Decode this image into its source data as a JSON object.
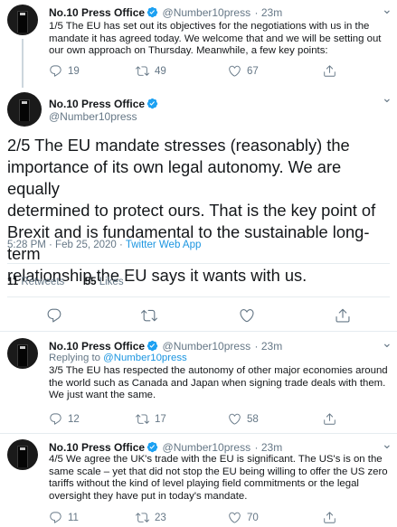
{
  "author": {
    "name": "No.10 Press Office",
    "handle": "@Number10press"
  },
  "tweets": [
    {
      "time": "· 23m",
      "text_lines": [
        "1/5 The EU has set out its objectives for the negotiations with us in the",
        "mandate it has agreed today.  We welcome that and we will be setting out",
        "our own approach on Thursday.  Meanwhile, a few key points:"
      ],
      "replies": "19",
      "retweets": "49",
      "likes": "67"
    },
    {
      "text_lines": [
        "2/5 The EU mandate stresses (reasonably) the",
        "importance of its own legal autonomy. We are equally",
        "determined to protect ours.  That is the key point of",
        "Brexit and is fundamental to the sustainable long-term",
        "relationship the EU says it wants with us."
      ],
      "timestamp": "5:28 PM · Feb 25, 2020 · ",
      "app": "Twitter Web App",
      "retweets_count": "11",
      "retweets_label": "Retweets",
      "likes_count": "55",
      "likes_label": "Likes"
    },
    {
      "time": "· 23m",
      "reply_prefix": "Replying to ",
      "reply_to": "@Number10press",
      "text_lines": [
        "3/5 The EU has respected the autonomy of other major economies around",
        "the world such as Canada and Japan when signing trade deals with them.",
        "We just want the same."
      ],
      "replies": "12",
      "retweets": "17",
      "likes": "58"
    },
    {
      "time": "· 23m",
      "text_lines": [
        "4/5 We agree the UK's trade with the EU is significant.  The US's is on the",
        "same scale – yet that did not stop the EU being willing to offer the US zero",
        "tariffs without the kind of level playing field commitments or the legal",
        "oversight they have put in today's mandate."
      ],
      "replies": "11",
      "retweets": "23",
      "likes": "70"
    }
  ],
  "colors": {
    "text": "#14171a",
    "muted": "#657786",
    "link": "#1b95e0",
    "verified": "#1da1f2",
    "divider": "#e6ecf0"
  },
  "icons": [
    "reply-icon",
    "retweet-icon",
    "like-icon",
    "share-icon",
    "verified-icon",
    "more-icon"
  ]
}
